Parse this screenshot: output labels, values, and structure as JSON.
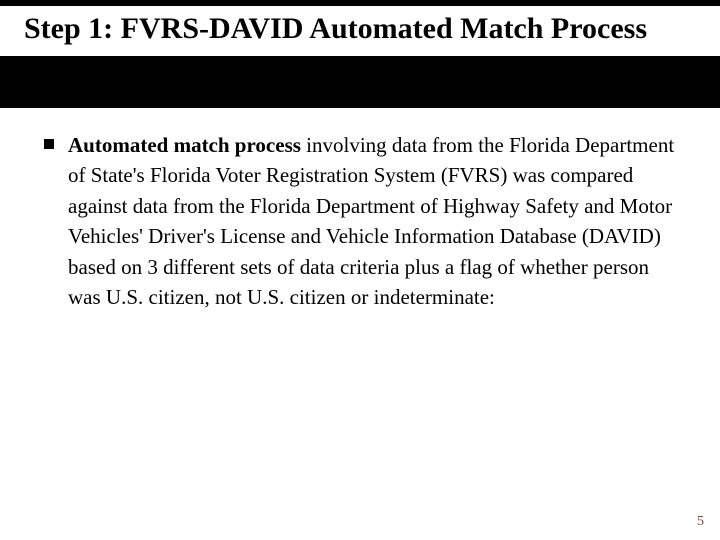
{
  "slide": {
    "title": "Step 1: FVRS-DAVID Automated Match Process",
    "bullet": {
      "lead": "Automated match process",
      "rest": " involving data from the Florida Department of State's Florida Voter Registration System (FVRS) was compared against data from the Florida Department of Highway Safety and Motor Vehicles' Driver's License and Vehicle Information Database (DAVID) based on 3 different sets of data criteria plus a flag of whether person was U.S. citizen, not U.S. citizen or indeterminate:"
    },
    "page_number": "5"
  }
}
